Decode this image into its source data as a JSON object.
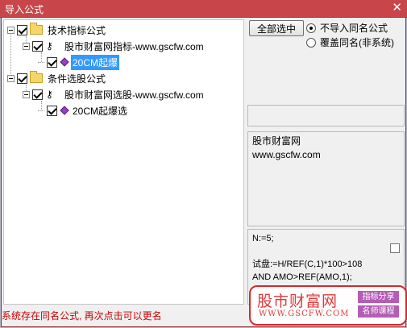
{
  "window": {
    "title": "导入公式",
    "close_label": "✕"
  },
  "tree": {
    "nodes": [
      {
        "label": "技术指标公式",
        "checked": true,
        "kind": "folder",
        "selected": false
      },
      {
        "label": "股市财富网指标-www.gscfw.com",
        "checked": true,
        "kind": "source",
        "selected": false
      },
      {
        "label": "20CM起爆",
        "checked": true,
        "kind": "formula",
        "selected": true
      },
      {
        "label": "条件选股公式",
        "checked": true,
        "kind": "folder",
        "selected": false
      },
      {
        "label": "股市财富网选股-www.gscfw.com",
        "checked": true,
        "kind": "source",
        "selected": false
      },
      {
        "label": "20CM起爆选",
        "checked": true,
        "kind": "formula",
        "selected": false
      }
    ]
  },
  "actions": {
    "select_all_label": "全部选中",
    "options": [
      {
        "label": "不导入同名公式",
        "selected": true
      },
      {
        "label": "覆盖同名(非系统)",
        "selected": false
      }
    ]
  },
  "description": {
    "line1": "股市财富网",
    "line2": "www.gscfw.com"
  },
  "code": {
    "lines": [
      "N:=5;",
      "",
      "试盘:=H/REF(C,1)*100>108",
      "AND AMO>REF(AMO,1);"
    ]
  },
  "status_text": "系统存在同名公式, 再次点击可以更名",
  "watermark": {
    "brand": "股市财富网",
    "url": "WWW.GSCFW.COM",
    "tag1": "指标分享",
    "tag2": "名师课程"
  },
  "colors": {
    "titlebar": "#c8464a",
    "selection": "#3399ff",
    "status": "#cc0000",
    "watermark": "#d42a2a"
  }
}
